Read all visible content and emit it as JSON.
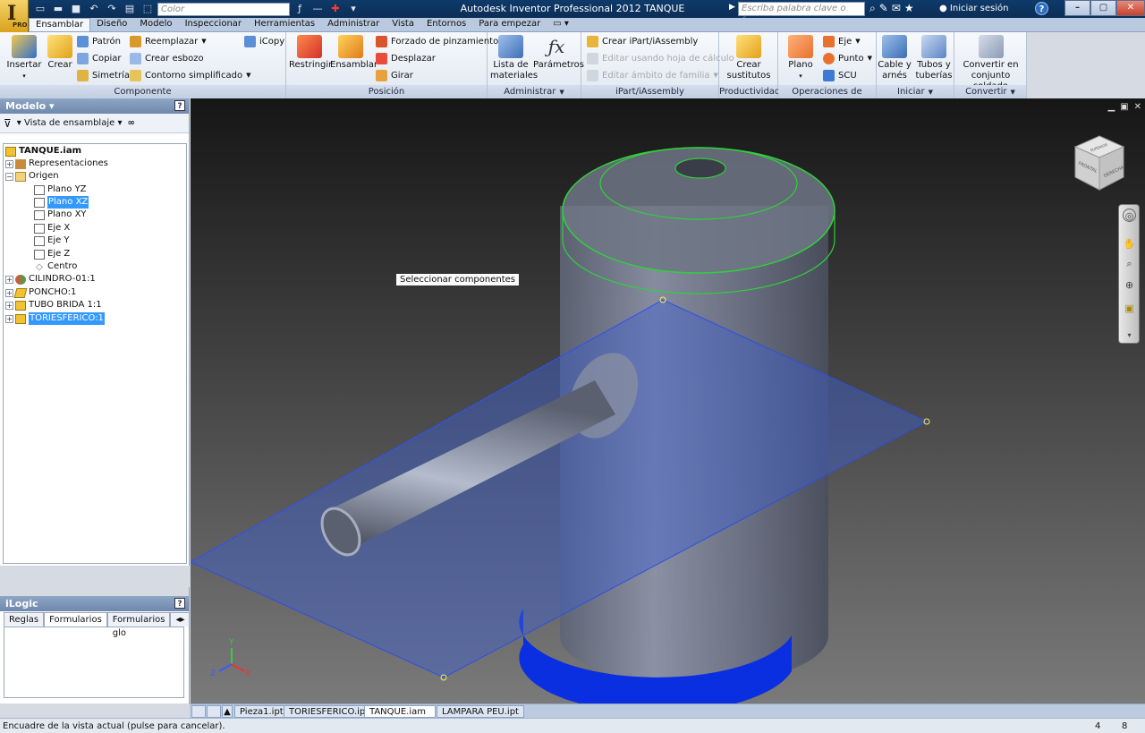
{
  "window": {
    "title": "Autodesk Inventor Professional 2012   TANQUE",
    "logo_text": "I",
    "logo_badge": "PRO",
    "color_combo": "Color",
    "search_placeholder": "Escriba palabra clave o frase",
    "signin": "Iniciar sesión",
    "help": "?"
  },
  "menu_tabs": [
    "Ensamblar",
    "Diseño",
    "Modelo",
    "Inspeccionar",
    "Herramientas",
    "Administrar",
    "Vista",
    "Entornos",
    "Para empezar"
  ],
  "ribbon": {
    "componente": {
      "title": "Componente",
      "insertar": "Insertar",
      "crear": "Crear",
      "patron": "Patrón",
      "copiar": "Copiar",
      "simetria": "Simetría",
      "reemplazar": "Reemplazar",
      "crear_esbozo": "Crear esbozo",
      "contorno": "Contorno simplificado",
      "icopy": "iCopy"
    },
    "posicion": {
      "title": "Posición",
      "restringir": "Restringir",
      "ensamblar": "Ensamblar",
      "forzado": "Forzado de pinzamiento",
      "desplazar": "Desplazar",
      "girar": "Girar"
    },
    "administrar": {
      "title": "Administrar",
      "lista_1": "Lista de",
      "lista_2": "materiales",
      "parametros": "Parámetros"
    },
    "ipart": {
      "title": "iPart/iAssembly",
      "crear": "Crear iPart/iAssembly",
      "editar_hoja": "Editar usando hoja de cálculo",
      "editar_ambito": "Editar ámbito de familia"
    },
    "productividad": {
      "title": "Productividad",
      "crear_1": "Crear",
      "crear_2": "sustitutos"
    },
    "operaciones": {
      "title": "Operaciones de trabajo",
      "plano": "Plano",
      "eje": "Eje",
      "punto": "Punto",
      "scu": "SCU"
    },
    "iniciar": {
      "title": "Iniciar",
      "cable_1": "Cable y",
      "cable_2": "arnés",
      "tubos_1": "Tubos y",
      "tubos_2": "tuberías"
    },
    "convertir": {
      "title": "Convertir",
      "convertir_1": "Convertir en",
      "convertir_2": "conjunto soldado"
    }
  },
  "browser": {
    "title": "Modelo",
    "view": "Vista de ensamblaje",
    "tree": [
      "TANQUE.iam",
      "Representaciones",
      "Origen",
      "Plano YZ",
      "Plano XZ",
      "Plano XY",
      "Eje X",
      "Eje Y",
      "Eje Z",
      "Centro",
      "CILINDRO-01:1",
      "PONCHO:1",
      "TUBO BRIDA 1:1",
      "TORIESFERICO:1"
    ]
  },
  "ilogic": {
    "title": "iLogic",
    "tabs": [
      "Reglas",
      "Formularios",
      "Formularios glo"
    ]
  },
  "viewport": {
    "tooltip": "Seleccionar componentes",
    "cube_front": "FRONTAL",
    "cube_right": "DERECHA",
    "cube_top": "SUPERIOR",
    "axis_x": "X",
    "axis_y": "Y",
    "axis_z": "Z"
  },
  "doc_tabs": [
    "Pieza1.ipt",
    "TORIESFERICO.ipt",
    "TANQUE.iam",
    "LAMPARA PEU.ipt"
  ],
  "status": {
    "message": "Encuadre de la vista actual (pulse para cancelar).",
    "count_a": "4",
    "count_b": "8"
  },
  "colors": {
    "plane": "#3f5fd0",
    "cap_edges": "#2fd13a",
    "bottom_ring": "#0a2fe0",
    "selection": "#3399ff"
  }
}
